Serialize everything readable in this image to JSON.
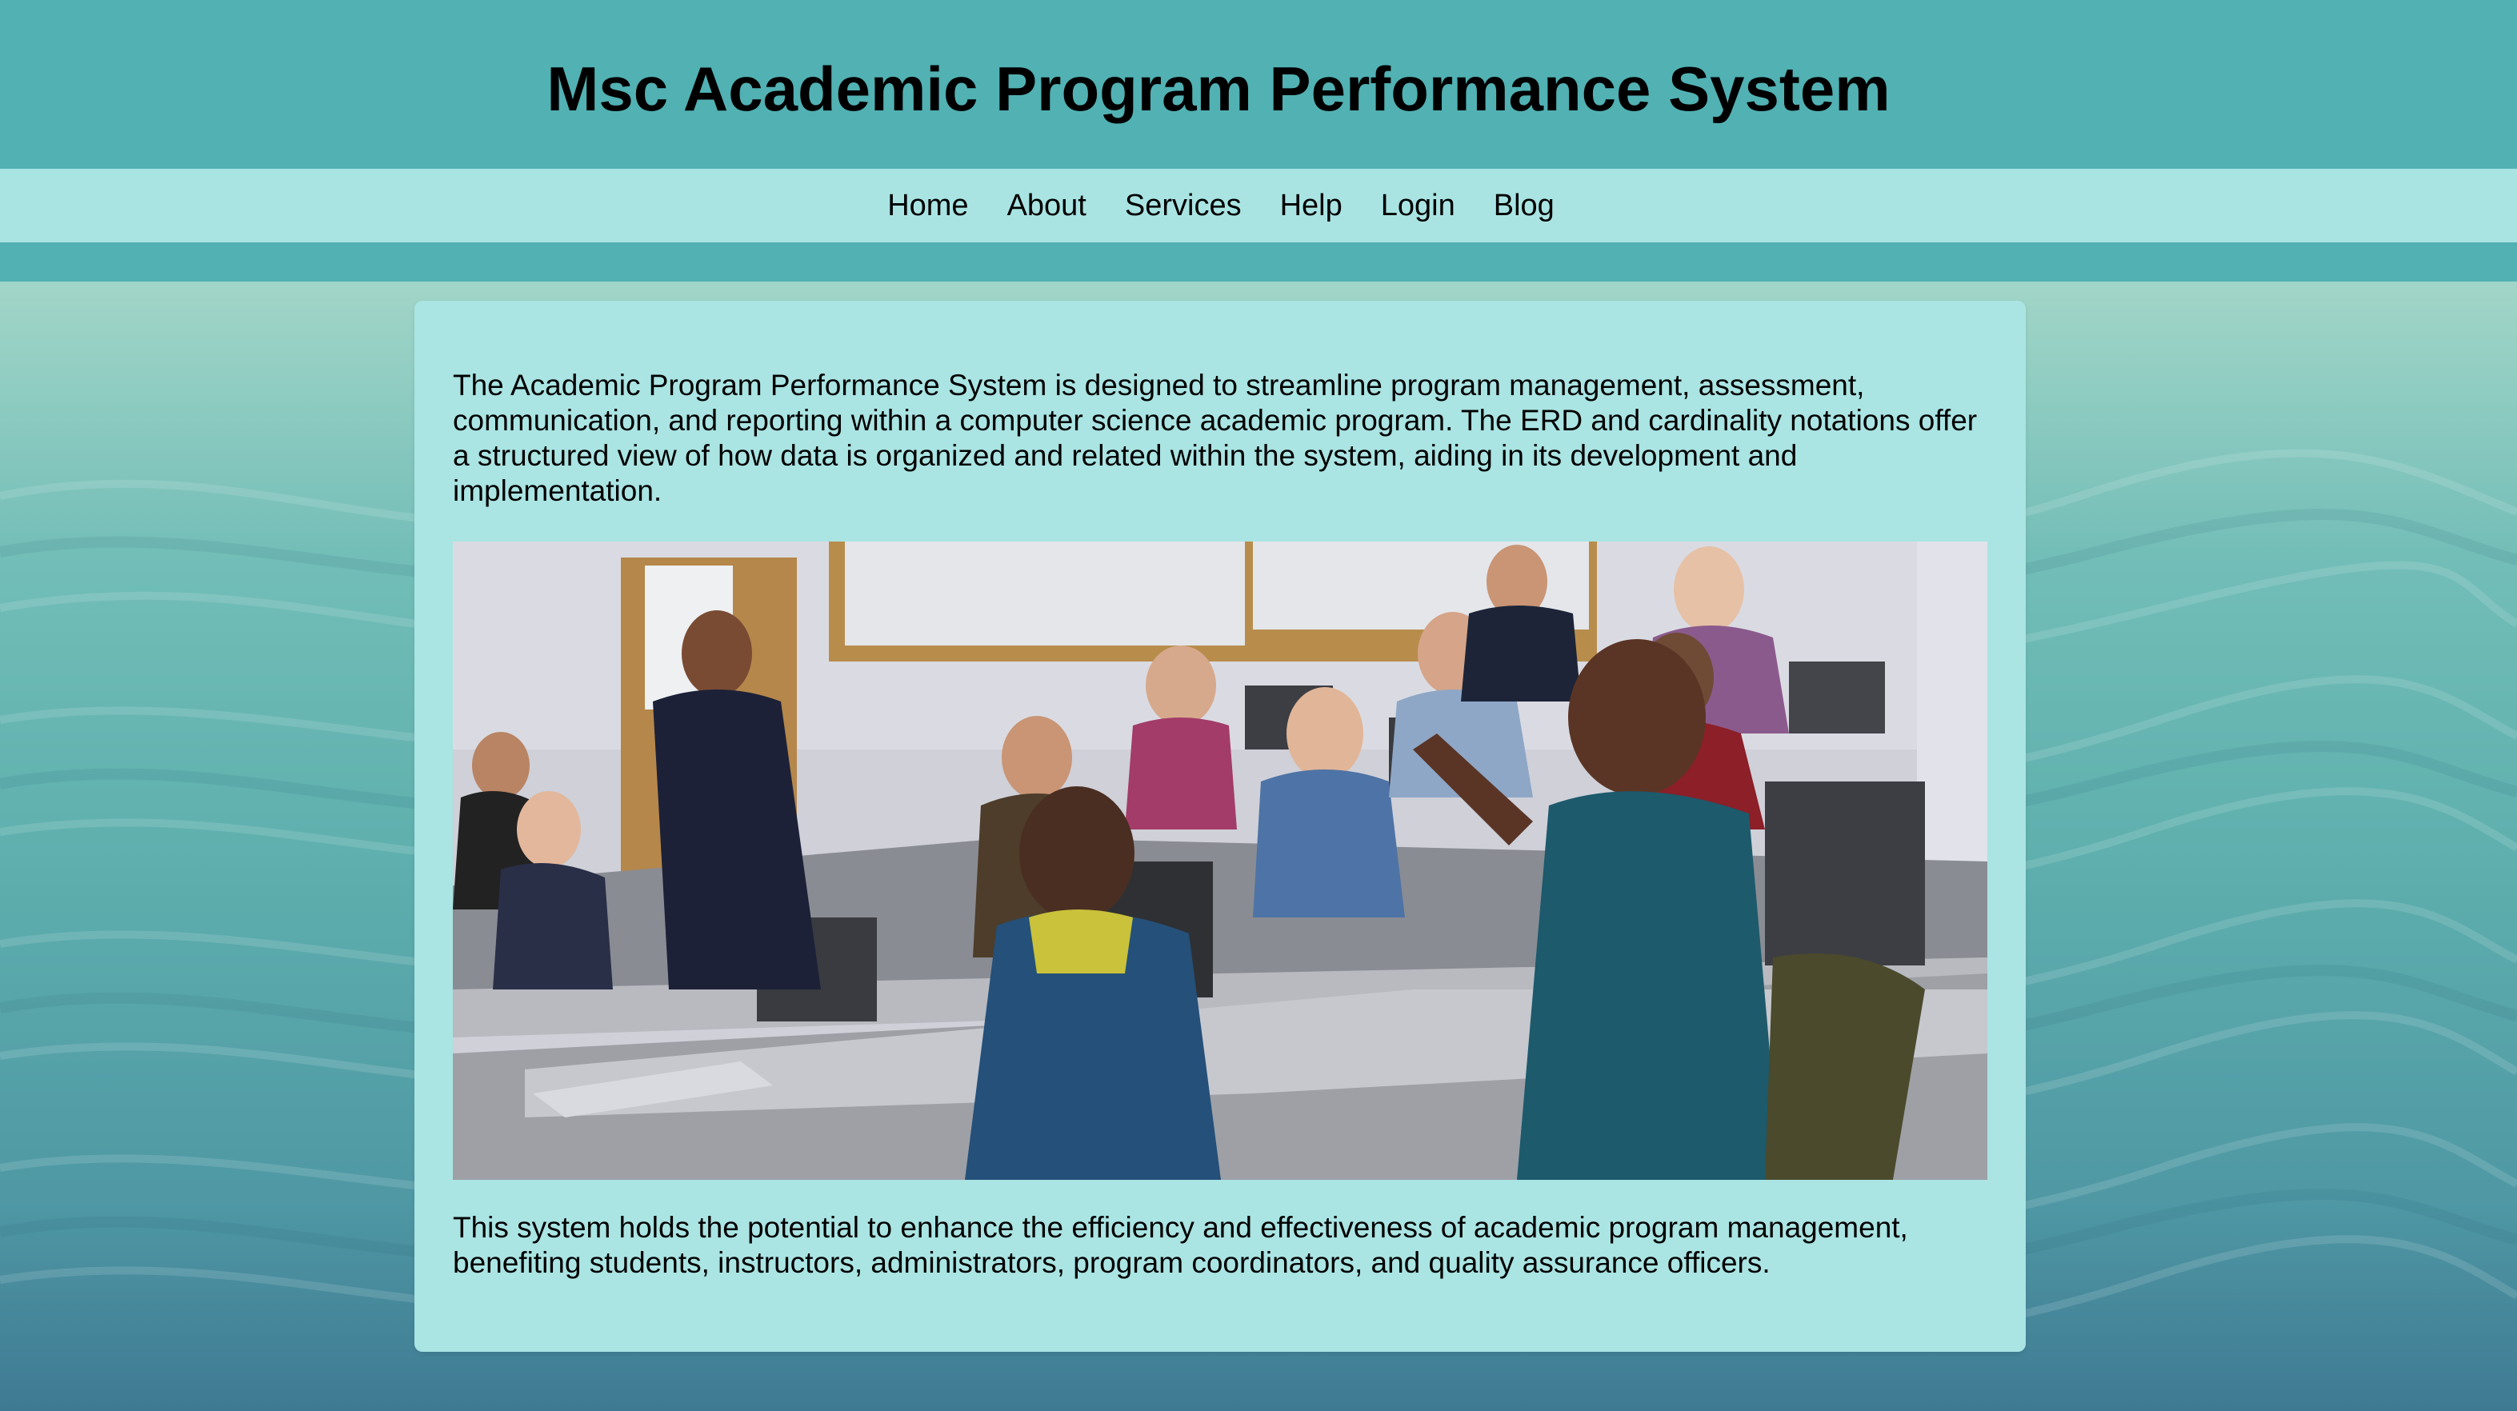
{
  "header": {
    "title": "Msc Academic Program Performance System"
  },
  "nav": {
    "items": [
      {
        "label": "Home"
      },
      {
        "label": "About"
      },
      {
        "label": "Services"
      },
      {
        "label": "Help"
      },
      {
        "label": "Login"
      },
      {
        "label": "Blog"
      }
    ]
  },
  "main": {
    "intro": "The Academic Program Performance System is designed to streamline program management, assessment, communication, and reporting within a computer science academic program. The ERD and cardinality notations offer a structured view of how data is organized and related within the system, aiding in its development and implementation.",
    "closing": "This system holds the potential to enhance the efficiency and effectiveness of academic program management, benefiting students, instructors, administrators, program coordinators, and quality assurance officers.",
    "image": {
      "label": "classroom-photo"
    }
  },
  "colors": {
    "header_bg": "#51b1b3",
    "nav_bg": "#a9e4e3",
    "card_bg": "#aae4e3",
    "text": "#000000"
  }
}
